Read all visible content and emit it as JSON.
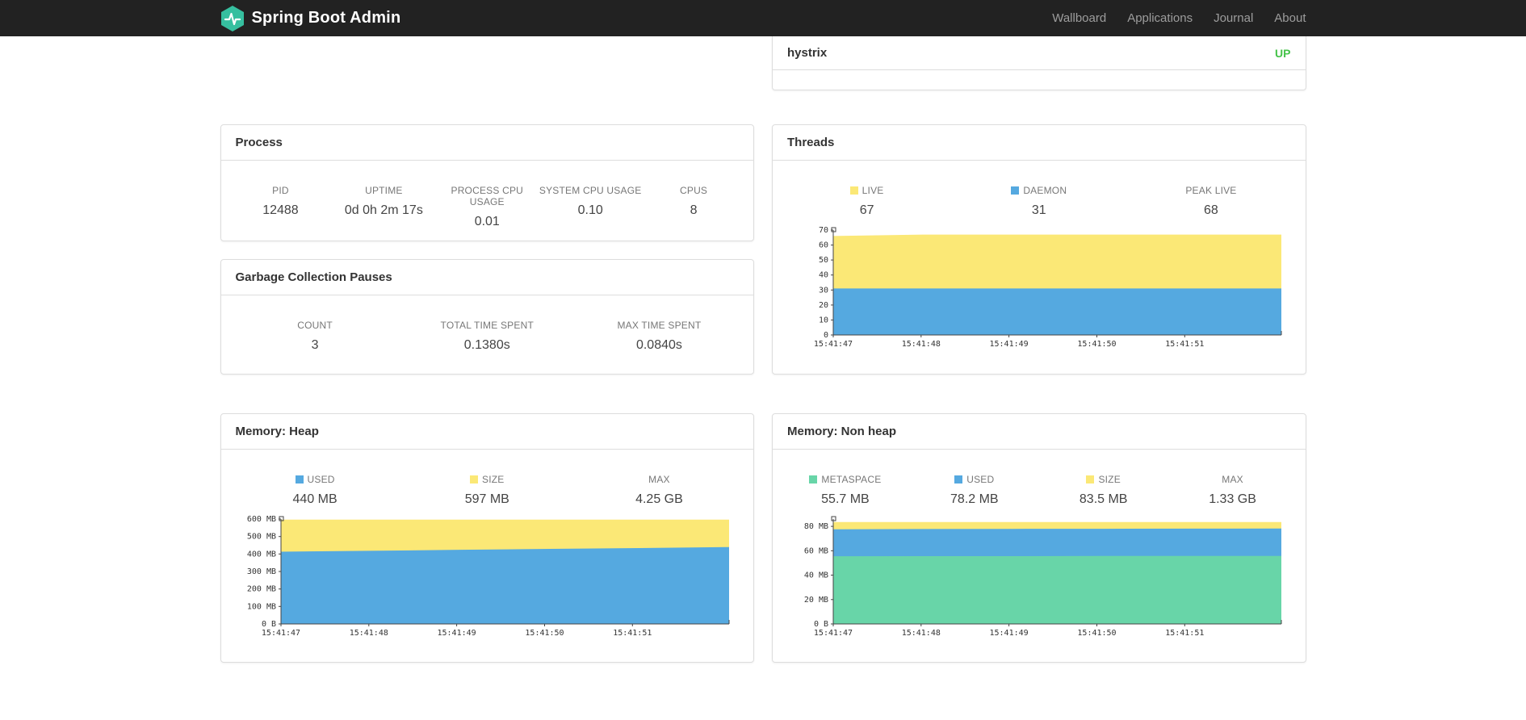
{
  "navbar": {
    "brand": "Spring Boot Admin",
    "items": [
      {
        "label": "Wallboard"
      },
      {
        "label": "Applications"
      },
      {
        "label": "Journal"
      },
      {
        "label": "About"
      }
    ]
  },
  "colors": {
    "navbar_bg": "#222222",
    "brand_teal": "#36bf9f",
    "up_green": "#46c34a",
    "series_yellow": "#fbe876",
    "series_blue": "#55a9e0",
    "series_green": "#68d5a8"
  },
  "application_card": {
    "name": "hystrix",
    "status": "UP"
  },
  "process": {
    "title": "Process",
    "stats": [
      {
        "label": "PID",
        "value": "12488"
      },
      {
        "label": "UPTIME",
        "value": "0d 0h 2m 17s"
      },
      {
        "label": "PROCESS CPU USAGE",
        "value": "0.01"
      },
      {
        "label": "SYSTEM CPU USAGE",
        "value": "0.10"
      },
      {
        "label": "CPUS",
        "value": "8"
      }
    ]
  },
  "gc": {
    "title": "Garbage Collection Pauses",
    "stats": [
      {
        "label": "COUNT",
        "value": "3"
      },
      {
        "label": "TOTAL TIME SPENT",
        "value": "0.1380s"
      },
      {
        "label": "MAX TIME SPENT",
        "value": "0.0840s"
      }
    ]
  },
  "threads": {
    "title": "Threads",
    "legend": [
      {
        "label": "LIVE",
        "value": "67",
        "color": "#fbe876"
      },
      {
        "label": "DAEMON",
        "value": "31",
        "color": "#55a9e0"
      },
      {
        "label": "PEAK LIVE",
        "value": "68",
        "color": null
      }
    ]
  },
  "memory_heap": {
    "title": "Memory: Heap",
    "legend": [
      {
        "label": "USED",
        "value": "440 MB",
        "color": "#55a9e0"
      },
      {
        "label": "SIZE",
        "value": "597 MB",
        "color": "#fbe876"
      },
      {
        "label": "MAX",
        "value": "4.25 GB",
        "color": null
      }
    ]
  },
  "memory_nonheap": {
    "title": "Memory: Non heap",
    "legend": [
      {
        "label": "METASPACE",
        "value": "55.7 MB",
        "color": "#68d5a8"
      },
      {
        "label": "USED",
        "value": "78.2 MB",
        "color": "#55a9e0"
      },
      {
        "label": "SIZE",
        "value": "83.5 MB",
        "color": "#fbe876"
      },
      {
        "label": "MAX",
        "value": "1.33 GB",
        "color": null
      }
    ]
  },
  "chart_data": [
    {
      "id": "threads",
      "type": "area",
      "title": "Threads",
      "x_labels": [
        "15:41:47",
        "15:41:48",
        "15:41:49",
        "15:41:50",
        "15:41:51"
      ],
      "ylim": [
        0,
        70
      ],
      "grid": false,
      "y_ticks": [
        {
          "label": "0",
          "value": 0
        },
        {
          "label": "10",
          "value": 10
        },
        {
          "label": "20",
          "value": 20
        },
        {
          "label": "30",
          "value": 30
        },
        {
          "label": "40",
          "value": 40
        },
        {
          "label": "50",
          "value": 50
        },
        {
          "label": "60",
          "value": 60
        },
        {
          "label": "70",
          "value": 70
        }
      ],
      "series": [
        {
          "name": "LIVE",
          "color": "#fbe876",
          "values": [
            66,
            67,
            67,
            67,
            67,
            67
          ]
        },
        {
          "name": "DAEMON",
          "color": "#55a9e0",
          "values": [
            31,
            31,
            31,
            31,
            31,
            31
          ]
        }
      ]
    },
    {
      "id": "memory-heap",
      "type": "area",
      "title": "Memory: Heap",
      "x_labels": [
        "15:41:47",
        "15:41:48",
        "15:41:49",
        "15:41:50",
        "15:41:51"
      ],
      "ylim": [
        0,
        600
      ],
      "grid": false,
      "y_ticks": [
        {
          "label": "0 B",
          "value": 0
        },
        {
          "label": "100 MB",
          "value": 100
        },
        {
          "label": "200 MB",
          "value": 200
        },
        {
          "label": "300 MB",
          "value": 300
        },
        {
          "label": "400 MB",
          "value": 400
        },
        {
          "label": "500 MB",
          "value": 500
        },
        {
          "label": "600 MB",
          "value": 600
        }
      ],
      "series": [
        {
          "name": "SIZE",
          "color": "#fbe876",
          "values": [
            597,
            597,
            597,
            597,
            597,
            597
          ]
        },
        {
          "name": "USED",
          "color": "#55a9e0",
          "values": [
            413,
            418,
            424,
            429,
            434,
            440
          ]
        }
      ]
    },
    {
      "id": "memory-nonheap",
      "type": "area",
      "title": "Memory: Non heap",
      "x_labels": [
        "15:41:47",
        "15:41:48",
        "15:41:49",
        "15:41:50",
        "15:41:51"
      ],
      "ylim": [
        0,
        86
      ],
      "grid": false,
      "y_ticks": [
        {
          "label": "0 B",
          "value": 0
        },
        {
          "label": "20 MB",
          "value": 20
        },
        {
          "label": "40 MB",
          "value": 40
        },
        {
          "label": "60 MB",
          "value": 60
        },
        {
          "label": "80 MB",
          "value": 80
        }
      ],
      "series": [
        {
          "name": "SIZE",
          "color": "#fbe876",
          "values": [
            83.5,
            83.5,
            83.5,
            83.5,
            83.5,
            83.5
          ]
        },
        {
          "name": "USED",
          "color": "#55a9e0",
          "values": [
            77.6,
            77.8,
            77.9,
            78.0,
            78.1,
            78.2
          ]
        },
        {
          "name": "METASPACE",
          "color": "#68d5a8",
          "values": [
            55.5,
            55.6,
            55.6,
            55.7,
            55.7,
            55.7
          ]
        }
      ]
    }
  ]
}
